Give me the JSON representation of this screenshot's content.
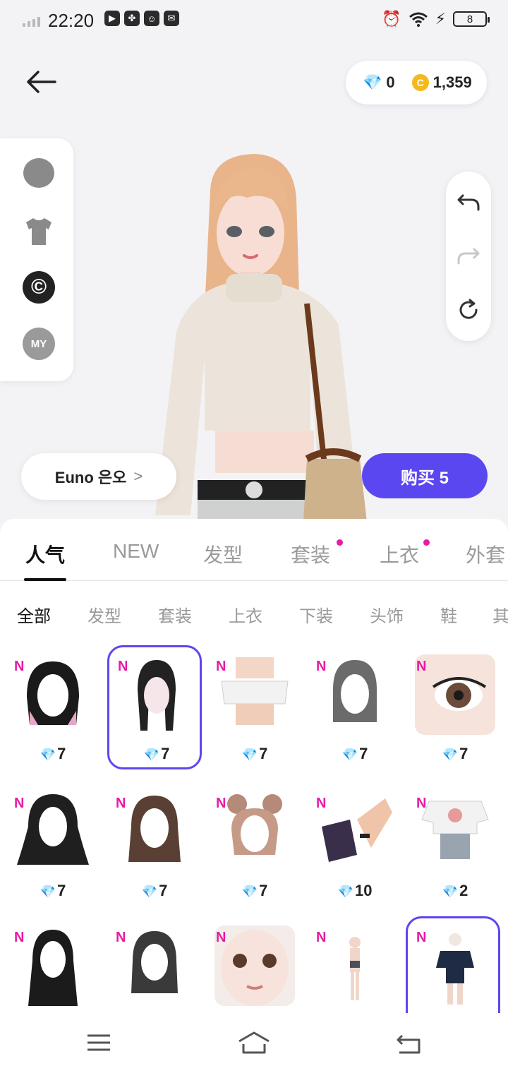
{
  "status_bar": {
    "time": "22:20",
    "battery": "8"
  },
  "currency": {
    "gems": "0",
    "coins": "1,359",
    "coin_symbol": "C"
  },
  "left_menu": {
    "copy_symbol": "©",
    "my_label": "MY"
  },
  "name_chip": {
    "label": "Euno 은오",
    "chevron": ">"
  },
  "buy_button": {
    "label": "购买 5"
  },
  "tabs": [
    {
      "label": "人气"
    },
    {
      "label": "NEW"
    },
    {
      "label": "发型"
    },
    {
      "label": "套装"
    },
    {
      "label": "上衣"
    },
    {
      "label": "外套"
    }
  ],
  "subtabs": [
    {
      "label": "全部"
    },
    {
      "label": "发型"
    },
    {
      "label": "套装"
    },
    {
      "label": "上衣"
    },
    {
      "label": "下装"
    },
    {
      "label": "头饰"
    },
    {
      "label": "鞋"
    },
    {
      "label": "其"
    }
  ],
  "badge_letter": "N",
  "items": [
    {
      "price": "7"
    },
    {
      "price": "7"
    },
    {
      "price": "7"
    },
    {
      "price": "7"
    },
    {
      "price": "7"
    },
    {
      "price": "7"
    },
    {
      "price": "7"
    },
    {
      "price": "7"
    },
    {
      "price": "10"
    },
    {
      "price": "2"
    },
    {
      "price": ""
    },
    {
      "price": ""
    },
    {
      "price": ""
    },
    {
      "price": ""
    },
    {
      "price": ""
    }
  ],
  "colors": {
    "accent": "#5b47f0",
    "gem": "#e81aa8",
    "coin": "#f6b81c"
  }
}
